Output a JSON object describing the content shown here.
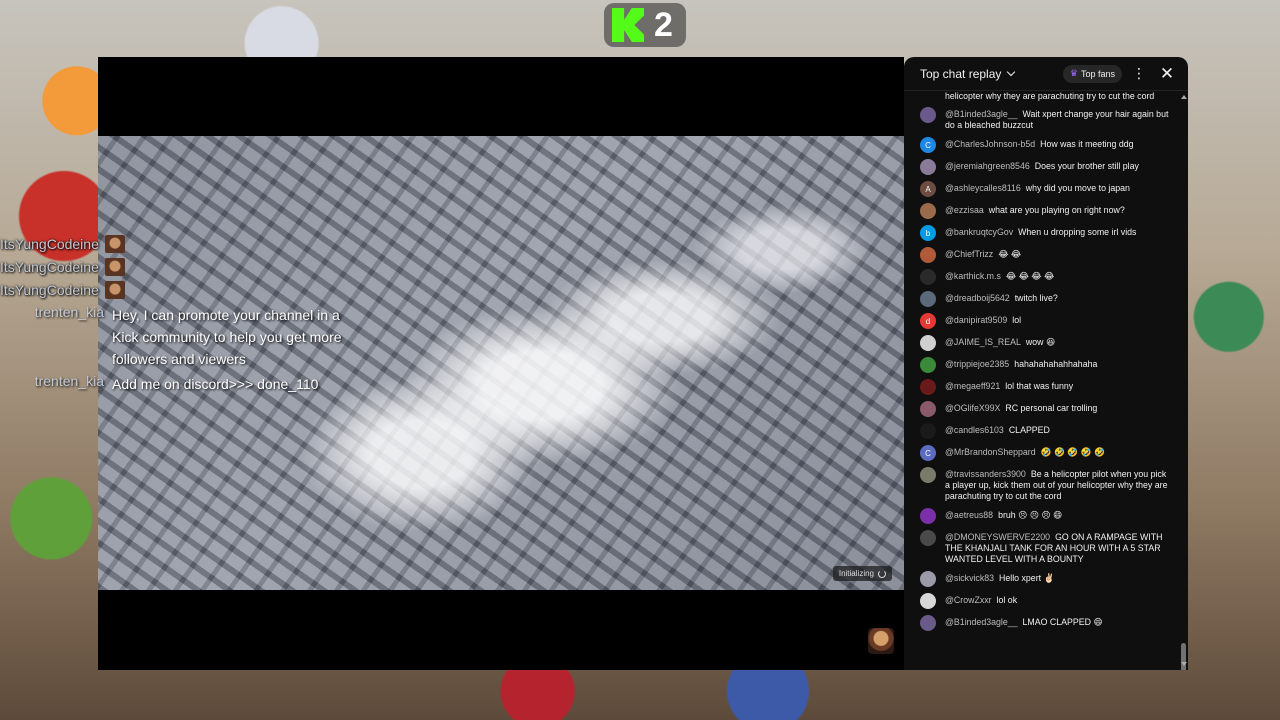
{
  "kick_badge": {
    "count": "2"
  },
  "player": {
    "status_text": "Initializing"
  },
  "overlay_chat": {
    "repeat_rows": [
      {
        "name": "ItsYungCodeine"
      },
      {
        "name": "ItsYungCodeine"
      },
      {
        "name": "ItsYungCodeine"
      }
    ],
    "messages": [
      {
        "name": "trenten_kia",
        "text": "Hey, I can promote your channel in a Kick community to help you get more followers and viewers"
      },
      {
        "name": "trenten_kia",
        "text": "Add me on discord>>> done_110"
      }
    ]
  },
  "chat_panel": {
    "title": "Top chat replay",
    "top_fans_label": "Top fans",
    "partial_top": "helicopter why they are parachuting try to cut the cord",
    "messages": [
      {
        "author": "@B1inded3agle__",
        "text": "Wait xpert change your hair again but do a bleached buzzcut",
        "avatar_letter": "",
        "avatar_color": "#6a5a8a"
      },
      {
        "author": "@CharlesJohnson-b5d",
        "text": "How was it meeting ddg",
        "avatar_letter": "C",
        "avatar_color": "#1e88e5"
      },
      {
        "author": "@jeremiahgreen8546",
        "text": "Does your brother still play",
        "avatar_letter": "",
        "avatar_color": "#8a7a9a"
      },
      {
        "author": "@ashleycalles8116",
        "text": "why did you move to japan",
        "avatar_letter": "A",
        "avatar_color": "#6d4c41"
      },
      {
        "author": "@ezzisaa",
        "text": "what are you playing on right now?",
        "avatar_letter": "",
        "avatar_color": "#9a6a4a"
      },
      {
        "author": "@bankruqtcyGov",
        "text": "When u dropping some irl vids",
        "avatar_letter": "b",
        "avatar_color": "#039be5"
      },
      {
        "author": "@ChiefTrizz",
        "text": "😂 😂",
        "avatar_letter": "",
        "avatar_color": "#b05a3a"
      },
      {
        "author": "@karthick.m.s",
        "text": "😂 😂 😂 😂",
        "avatar_letter": "",
        "avatar_color": "#2a2a2a"
      },
      {
        "author": "@dreadboij5642",
        "text": "twitch live?",
        "avatar_letter": "",
        "avatar_color": "#5a6a7a"
      },
      {
        "author": "@danipirat9509",
        "text": "lol",
        "avatar_letter": "d",
        "avatar_color": "#e53935"
      },
      {
        "author": "@JAIME_IS_REAL",
        "text": "wow 😆",
        "avatar_letter": "",
        "avatar_color": "#cfcfcf"
      },
      {
        "author": "@trippiejoe2385",
        "text": "hahahahahahhahaha",
        "avatar_letter": "",
        "avatar_color": "#3a8a3a"
      },
      {
        "author": "@megaeff921",
        "text": "lol that was funny",
        "avatar_letter": "",
        "avatar_color": "#6a1a1a"
      },
      {
        "author": "@OGlifeX99X",
        "text": "RC personal car trolling",
        "avatar_letter": "",
        "avatar_color": "#8a5a6a"
      },
      {
        "author": "@candles6103",
        "text": "CLAPPED",
        "avatar_letter": "",
        "avatar_color": "#1a1a1a"
      },
      {
        "author": "@MrBrandonSheppard",
        "text": "🤣 🤣 🤣 🤣 🤣",
        "avatar_letter": "C",
        "avatar_color": "#5c6bc0"
      },
      {
        "author": "@travissanders3900",
        "text": "Be a helicopter pilot when you pick a player up, kick them out of your helicopter why they are parachuting try to cut the cord",
        "avatar_letter": "",
        "avatar_color": "#7a7a6a"
      },
      {
        "author": "@aetreus88",
        "text": "bruh 😣 😣 😣 😄",
        "avatar_letter": "",
        "avatar_color": "#7b2fa8"
      },
      {
        "author": "@DMONEYSWERVE2200",
        "text": "GO ON A RAMPAGE WITH THE KHANJALI TANK FOR AN HOUR WITH A 5 STAR WANTED LEVEL WITH A BOUNTY",
        "avatar_letter": "",
        "avatar_color": "#4a4a4a"
      },
      {
        "author": "@sickvick83",
        "text": "Hello xpert ✌🏻",
        "avatar_letter": "",
        "avatar_color": "#9a9aa8"
      },
      {
        "author": "@CrowZxxr",
        "text": "lol ok",
        "avatar_letter": "",
        "avatar_color": "#d8d8d8"
      },
      {
        "author": "@B1inded3agle__",
        "text": "LMAO CLAPPED 😄",
        "avatar_letter": "",
        "avatar_color": "#6a5a8a"
      }
    ]
  }
}
